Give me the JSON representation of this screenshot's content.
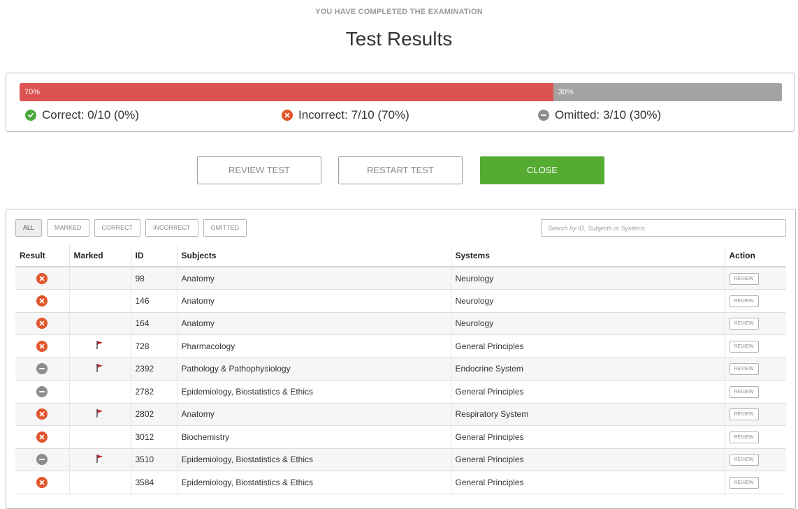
{
  "header": {
    "eyebrow": "YOU HAVE COMPLETED THE EXAMINATION",
    "title": "Test Results"
  },
  "summary": {
    "progress": [
      {
        "key": "incorrect",
        "label": "70%",
        "percent": 70,
        "color": "#dc5451"
      },
      {
        "key": "omitted",
        "label": "30%",
        "percent": 30,
        "color": "#a3a3a3"
      }
    ],
    "correct": {
      "label": "Correct:",
      "value": "0/10 (0%)",
      "icon": "check-circle-icon"
    },
    "incorrect": {
      "label": "Incorrect:",
      "value": "7/10 (70%)",
      "icon": "x-circle-icon"
    },
    "omitted": {
      "label": "Omitted:",
      "value": "3/10 (30%)",
      "icon": "minus-circle-icon"
    }
  },
  "actions": {
    "review": "REVIEW TEST",
    "restart": "RESTART TEST",
    "close": "CLOSE"
  },
  "filters": [
    "ALL",
    "MARKED",
    "CORRECT",
    "INCORRECT",
    "OMITTED"
  ],
  "active_filter": "ALL",
  "search": {
    "placeholder": "Search by ID, Subjects or Systems"
  },
  "columns": [
    "Result",
    "Marked",
    "ID",
    "Subjects",
    "Systems",
    "Action"
  ],
  "rows": [
    {
      "result": "incorrect",
      "marked": false,
      "id": "98",
      "subject": "Anatomy",
      "system": "Neurology",
      "action": "REVIEW"
    },
    {
      "result": "incorrect",
      "marked": false,
      "id": "146",
      "subject": "Anatomy",
      "system": "Neurology",
      "action": "REVIEW"
    },
    {
      "result": "incorrect",
      "marked": false,
      "id": "164",
      "subject": "Anatomy",
      "system": "Neurology",
      "action": "REVIEW"
    },
    {
      "result": "incorrect",
      "marked": true,
      "id": "728",
      "subject": "Pharmacology",
      "system": "General Principles",
      "action": "REVIEW"
    },
    {
      "result": "omitted",
      "marked": true,
      "id": "2392",
      "subject": "Pathology & Pathophysiology",
      "system": "Endocrine System",
      "action": "REVIEW"
    },
    {
      "result": "omitted",
      "marked": false,
      "id": "2782",
      "subject": "Epidemiology, Biostatistics & Ethics",
      "system": "General Principles",
      "action": "REVIEW"
    },
    {
      "result": "incorrect",
      "marked": true,
      "id": "2802",
      "subject": "Anatomy",
      "system": "Respiratory System",
      "action": "REVIEW"
    },
    {
      "result": "incorrect",
      "marked": false,
      "id": "3012",
      "subject": "Biochemistry",
      "system": "General Principles",
      "action": "REVIEW"
    },
    {
      "result": "omitted",
      "marked": true,
      "id": "3510",
      "subject": "Epidemiology, Biostatistics & Ethics",
      "system": "General Principles",
      "action": "REVIEW"
    },
    {
      "result": "incorrect",
      "marked": false,
      "id": "3584",
      "subject": "Epidemiology, Biostatistics & Ethics",
      "system": "General Principles",
      "action": "REVIEW"
    }
  ],
  "colors": {
    "incorrect": "#e1552b",
    "omitted": "#8d8d8d",
    "correct": "#4aa93d",
    "flag": "#c0282b",
    "close_button": "#55ab32"
  }
}
